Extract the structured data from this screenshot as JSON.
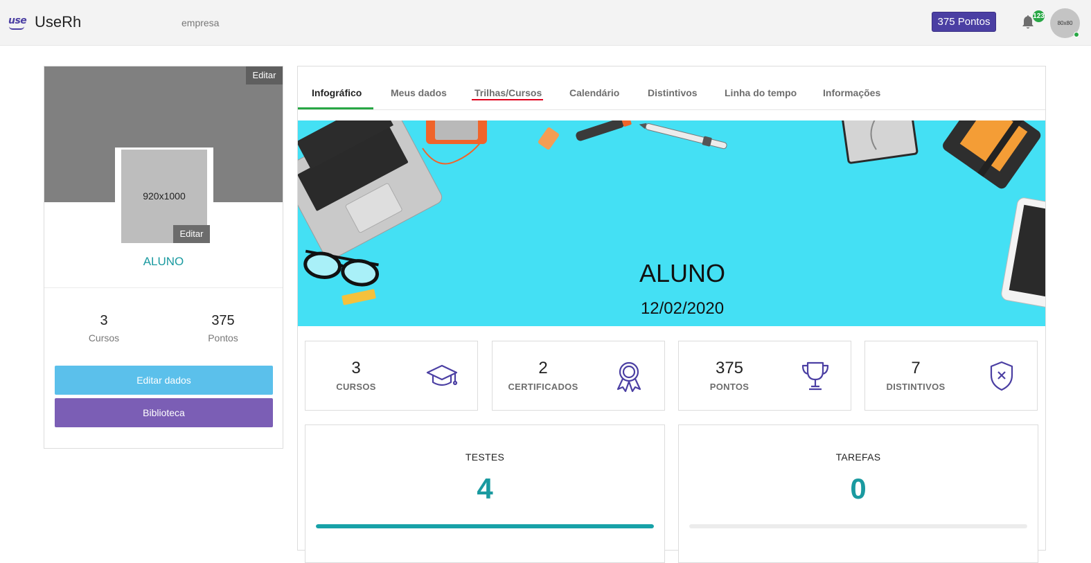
{
  "header": {
    "logo_mark": "use",
    "app_title": "UseRh",
    "company": "empresa",
    "points_button": "375 Pontos",
    "notification_count": "123",
    "avatar_placeholder": "80x80"
  },
  "profile": {
    "cover_edit_label": "Editar",
    "photo_placeholder": "920x1000",
    "photo_edit_label": "Editar",
    "name": "ALUNO",
    "stats": [
      {
        "value": "3",
        "label": "Cursos"
      },
      {
        "value": "375",
        "label": "Pontos"
      }
    ],
    "edit_button": "Editar dados",
    "library_button": "Biblioteca"
  },
  "tabs": [
    {
      "label": "Infográfico",
      "active": true
    },
    {
      "label": "Meus dados",
      "active": false
    },
    {
      "label": "Trilhas/Cursos",
      "active": false
    },
    {
      "label": "Calendário",
      "active": false
    },
    {
      "label": "Distintivos",
      "active": false
    },
    {
      "label": "Linha do tempo",
      "active": false
    },
    {
      "label": "Informações",
      "active": false
    }
  ],
  "banner": {
    "name": "ALUNO",
    "date": "12/02/2020"
  },
  "stat_cards": [
    {
      "value": "3",
      "label": "CURSOS",
      "icon": "graduation-cap-icon"
    },
    {
      "value": "2",
      "label": "CERTIFICADOS",
      "icon": "award-ribbon-icon"
    },
    {
      "value": "375",
      "label": "PONTOS",
      "icon": "trophy-icon"
    },
    {
      "value": "7",
      "label": "DISTINTIVOS",
      "icon": "shield-x-icon"
    }
  ],
  "summary_cards": [
    {
      "title": "TESTES",
      "value": "4",
      "progress": 1.0
    },
    {
      "title": "TAREFAS",
      "value": "0",
      "progress": 0.0
    }
  ],
  "colors": {
    "brand": "#4b3fa3",
    "accent": "#1a9aa0",
    "banner": "#44e0f4",
    "active_tab": "#28a745",
    "edit_button": "#5bc0eb",
    "library_button": "#7b5eb5",
    "icon": "#4b3fa3"
  }
}
